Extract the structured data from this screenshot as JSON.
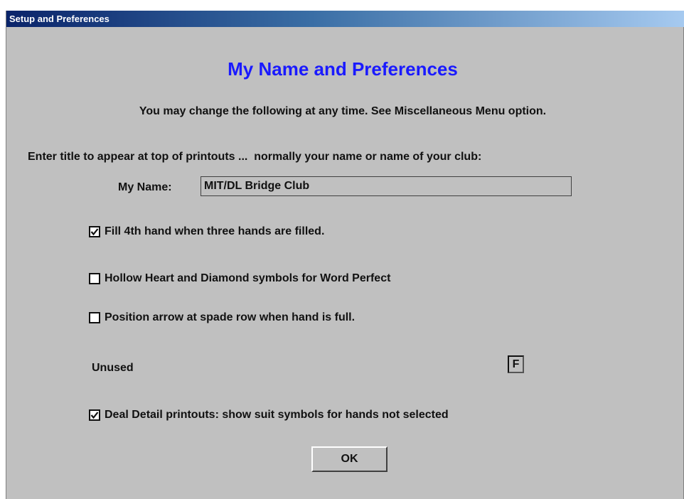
{
  "window": {
    "title": "Setup and Preferences"
  },
  "main": {
    "heading": "My Name and Preferences",
    "intro": "You may change the following at any time. See Miscellaneous Menu option.",
    "prompt": "Enter title to appear at top of printouts ...  normally your name or name of your club:",
    "name_label": "My Name:",
    "name_value": "MIT/DL Bridge Club"
  },
  "options": [
    {
      "label": "Fill 4th hand when three hands are filled.",
      "checked": true
    },
    {
      "label": "Hollow Heart and Diamond symbols for Word Perfect",
      "checked": false
    },
    {
      "label": "Position arrow at spade row when hand is full.",
      "checked": false
    },
    {
      "label": "Deal Detail printouts: show suit symbols for hands not selected",
      "checked": true
    }
  ],
  "unused": {
    "label": "Unused",
    "value": "F"
  },
  "buttons": {
    "ok_label": "OK"
  },
  "colors": {
    "heading": "#1a1aff",
    "background": "#c0c0c0",
    "title_bar_start": "#0a246a",
    "title_bar_end": "#a6caf0"
  }
}
